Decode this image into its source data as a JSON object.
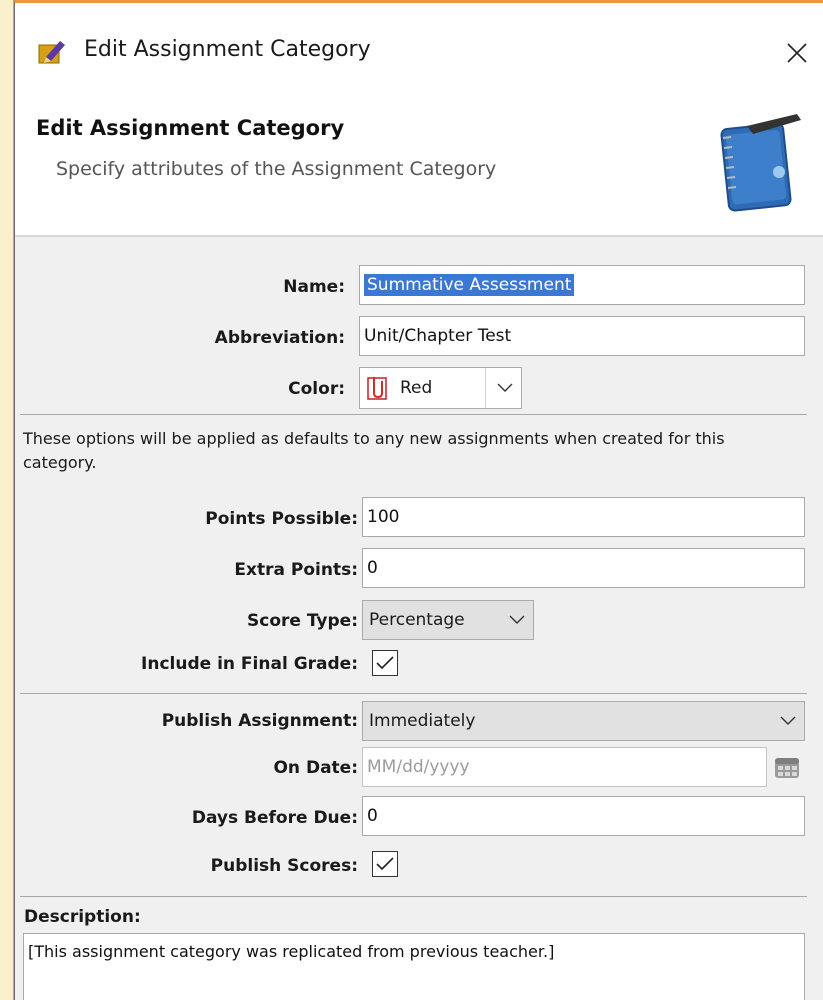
{
  "window": {
    "title": "Edit Assignment Category",
    "title_icon": "pencil-icon",
    "close_icon": "close-icon"
  },
  "header": {
    "title": "Edit Assignment Category",
    "subtitle": "Specify attributes of the Assignment Category",
    "icon": "notebook-icon"
  },
  "form": {
    "name_label": "Name:",
    "name_value": "Summative Assessment",
    "abbreviation_label": "Abbreviation:",
    "abbreviation_value": "Unit/Chapter Test",
    "color_label": "Color:",
    "color_value": "Red",
    "color_swatch_icon": "red-paperclip-icon",
    "defaults_note": "These options will be applied as defaults to any new assignments when created for this category.",
    "points_possible_label": "Points Possible:",
    "points_possible_value": "100",
    "extra_points_label": "Extra Points:",
    "extra_points_value": "0",
    "score_type_label": "Score Type:",
    "score_type_value": "Percentage",
    "include_final_label": "Include in Final Grade:",
    "include_final_checked": true,
    "publish_assignment_label": "Publish Assignment:",
    "publish_assignment_value": "Immediately",
    "on_date_label": "On Date:",
    "on_date_placeholder": "MM/dd/yyyy",
    "days_before_due_label": "Days Before Due:",
    "days_before_due_value": "0",
    "publish_scores_label": "Publish Scores:",
    "publish_scores_checked": true,
    "description_label": "Description:",
    "description_value": "[This assignment category was replicated from previous teacher.]"
  },
  "colors": {
    "selection": "#3a78d4",
    "window_accent": "#e89a3c",
    "panel_bg": "#f0f0f0"
  }
}
